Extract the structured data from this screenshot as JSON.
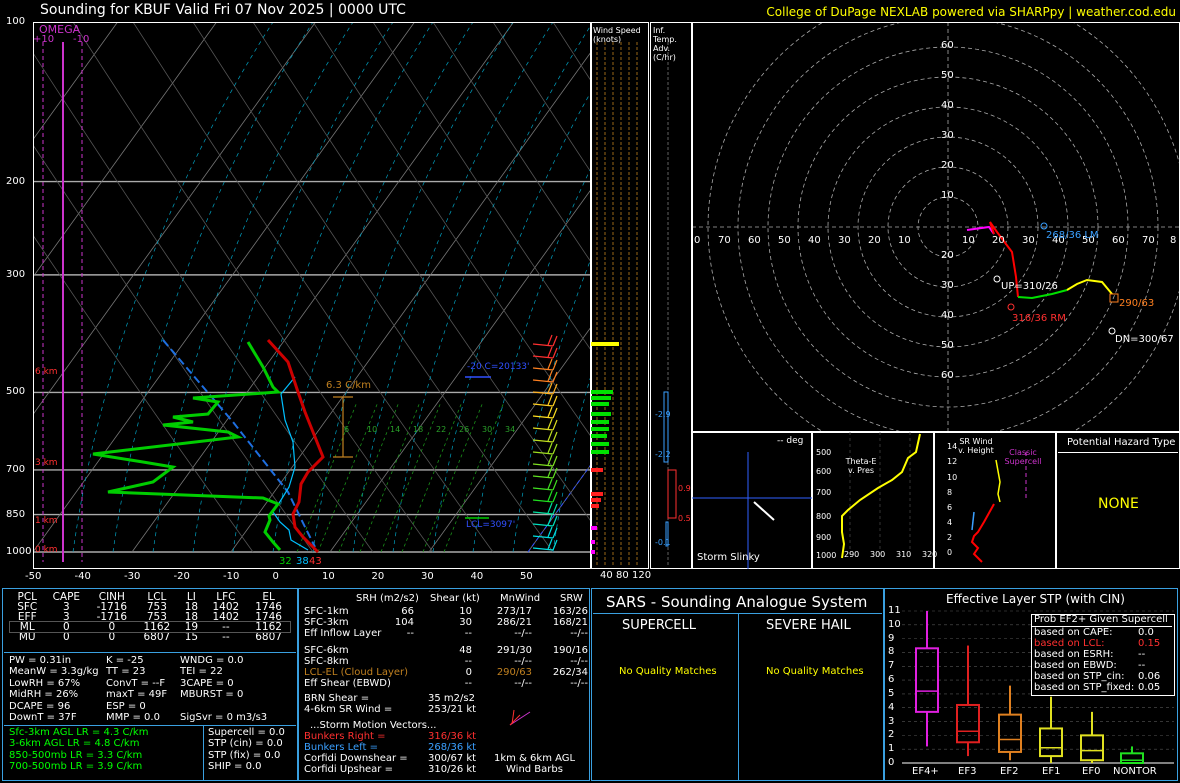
{
  "header": {
    "title": "Sounding for KBUF Valid  Fri 07 Nov 2025 | 0000 UTC",
    "credit": "College of DuPage NEXLAB powered via SHARPpy | weather.cod.edu"
  },
  "skewt": {
    "pressure_labels": [
      "100",
      "200",
      "300",
      "500",
      "700",
      "850",
      "1000"
    ],
    "temp_labels": [
      "-50",
      "-40",
      "-30",
      "-20",
      "-10",
      "0",
      "10",
      "20",
      "30",
      "40",
      "50"
    ],
    "omega_title": "OMEGA",
    "omega_plus": "+10",
    "omega_minus": "-10",
    "height_labels": [
      "6 km",
      "3 km",
      "1 km",
      "0 km"
    ],
    "lapse_rate": "6.3 C/km",
    "wetbulb_zero": "-20 C=20133'",
    "lcl_label": "LCL=3097'",
    "mixing_labels": [
      "6",
      "10",
      "14",
      "18",
      "22",
      "26",
      "30",
      "34"
    ],
    "sfc_labels": {
      "td": "32",
      "tw": "38",
      "t": "43"
    },
    "colors": {
      "temp": "#cc0000",
      "dewpoint": "#00cc00",
      "wetbulb": "#00c0ff",
      "parcel": "#1e6fe0",
      "omega": "#cc33cc"
    }
  },
  "wind_speed": {
    "title": "Wind Speed (knots)",
    "ticks": [
      "40",
      "80",
      "120"
    ]
  },
  "temp_adv": {
    "title": "Inf. Temp. Adv. (C/hr)",
    "values": [
      "-2.9",
      "-2.2",
      "0.9",
      "0.5",
      "-0.1"
    ]
  },
  "hodograph": {
    "ring_labels": [
      "60",
      "50",
      "40",
      "30",
      "20",
      "10",
      "20",
      "30",
      "40",
      "50",
      "60"
    ],
    "axis_labels": [
      "0",
      "70",
      "60",
      "50",
      "40",
      "30",
      "20",
      "10",
      "10",
      "20",
      "30",
      "40",
      "50",
      "60",
      "70",
      "8"
    ],
    "lm": "268/36 LM",
    "up": "UP=310/26",
    "rm": "316/36 RM",
    "mean": "290/63",
    "dn": "DN=300/67"
  },
  "storm_slinky": {
    "deg": "-- deg",
    "label": "Storm Slinky"
  },
  "thetae": {
    "title": "Theta-E v. Pres",
    "y_ticks": [
      "500",
      "600",
      "700",
      "800",
      "900",
      "1000"
    ],
    "x_ticks": [
      "290",
      "300",
      "310",
      "320"
    ]
  },
  "sr_wind": {
    "title": "SR Wind v. Height",
    "supercell": "Classic Supercell",
    "y_ticks": [
      "14",
      "12",
      "10",
      "8",
      "6",
      "4",
      "2",
      "0"
    ]
  },
  "hazard": {
    "title": "Potential Hazard Type",
    "value": "NONE"
  },
  "parcels": {
    "headers": [
      "PCL",
      "CAPE",
      "CINH",
      "LCL",
      "LI",
      "LFC",
      "EL"
    ],
    "rows": [
      [
        "SFC",
        "3",
        "-1716",
        "753",
        "18",
        "1402",
        "1746"
      ],
      [
        "EFF",
        "3",
        "-1716",
        "753",
        "18",
        "1402",
        "1746"
      ],
      [
        "ML",
        "0",
        "0",
        "1162",
        "19",
        "--",
        "1162"
      ],
      [
        "MU",
        "0",
        "0",
        "6807",
        "15",
        "--",
        "6807"
      ]
    ]
  },
  "indices": {
    "col1": [
      "PW = 0.31in",
      "MeanW = 3.3g/kg",
      "LowRH = 67%",
      "MidRH = 26%",
      "DCAPE = 96",
      "DownT = 37F"
    ],
    "col2": [
      "K = -25",
      "TT = 23",
      "ConvT = --F",
      "maxT = 49F",
      "ESP = 0",
      "MMP = 0.0"
    ],
    "col3": [
      "WNDG = 0.0",
      "TEI = 22",
      "3CAPE = 0",
      "MBURST = 0",
      "",
      "SigSvr = 0 m3/s3"
    ]
  },
  "lapse_rates": [
    "Sfc-3km AGL LR = 4.3 C/km",
    "3-6km AGL LR = 4.8 C/km",
    "850-500mb LR = 3.3 C/km",
    "700-500mb LR = 3.9 C/km"
  ],
  "composite": [
    "Supercell = 0.0",
    "STP (cin) = 0.0",
    "STP (fix) = 0.0",
    "SHIP = 0.0"
  ],
  "kinematics": {
    "headers": [
      "SRH (m2/s2)",
      "Shear (kt)",
      "MnWind",
      "SRW"
    ],
    "rows": [
      [
        "SFC-1km",
        "66",
        "10",
        "273/17",
        "163/26"
      ],
      [
        "SFC-3km",
        "104",
        "30",
        "286/21",
        "168/21"
      ],
      [
        "Eff Inflow Layer",
        "--",
        "--",
        "--/--",
        "--/--"
      ],
      [
        "",
        "",
        "",
        "",
        ""
      ],
      [
        "SFC-6km",
        "",
        "48",
        "291/30",
        "190/16"
      ],
      [
        "SFC-8km",
        "",
        "--",
        "--/--",
        "--/--"
      ],
      [
        "LCL-EL (Cloud Layer)",
        "",
        "0",
        "290/63",
        "262/34"
      ],
      [
        "Eff Shear (EBWD)",
        "",
        "--",
        "--/--",
        "--/--"
      ]
    ],
    "brn_shear": "BRN Shear =",
    "brn_shear_val": "35 m2/s2",
    "srwind_46": "4-6km SR Wind =",
    "srwind_46_val": "253/21 kt",
    "storm_motion": "...Storm Motion Vectors...",
    "bunkers_right": "Bunkers Right =",
    "bunkers_right_val": "316/36 kt",
    "bunkers_left": "Bunkers Left =",
    "bunkers_left_val": "268/36 kt",
    "corfidi_down": "Corfidi Downshear =",
    "corfidi_down_val": "300/67 kt",
    "corfidi_up": "Corfidi Upshear =",
    "corfidi_up_val": "310/26 kt",
    "barbs_label_1": "1km & 6km AGL",
    "barbs_label_2": "Wind Barbs"
  },
  "sars": {
    "title": "SARS - Sounding Analogue System",
    "supercell": "SUPERCELL",
    "hail": "SEVERE HAIL",
    "no_match_1": "No Quality Matches",
    "no_match_2": "No Quality Matches"
  },
  "stp": {
    "title": "Effective Layer STP (with CIN)",
    "y_ticks": [
      "11",
      "10",
      "9",
      "8",
      "7",
      "6",
      "5",
      "4",
      "3",
      "2",
      "1",
      "0"
    ],
    "categories": [
      "EF4+",
      "EF3",
      "EF2",
      "EF1",
      "EF0",
      "NONTOR"
    ],
    "legend_title": "Prob EF2+ Given Supercell",
    "legend_rows": [
      [
        "based on CAPE:",
        "0.0"
      ],
      [
        "based on LCL:",
        "0.15"
      ],
      [
        "based on ESRH:",
        "--"
      ],
      [
        "based on EBWD:",
        "--"
      ],
      [
        "based on STP_cin:",
        "0.06"
      ],
      [
        "based on STP_fixed:",
        "0.05"
      ]
    ]
  },
  "chart_data": {
    "type": "box",
    "title": "Effective Layer STP (with CIN)",
    "categories": [
      "EF4+",
      "EF3",
      "EF2",
      "EF1",
      "EF0",
      "NONTOR"
    ],
    "ylim": [
      0,
      11
    ],
    "series": [
      {
        "stat": "whisker_low",
        "values": [
          1.2,
          0.5,
          0.2,
          0.0,
          0.0,
          0.0
        ]
      },
      {
        "stat": "q1",
        "values": [
          3.7,
          1.5,
          0.8,
          0.5,
          0.2,
          0.0
        ]
      },
      {
        "stat": "median",
        "values": [
          5.2,
          2.3,
          1.7,
          1.1,
          0.9,
          0.2
        ]
      },
      {
        "stat": "q3",
        "values": [
          8.3,
          4.2,
          3.5,
          2.5,
          2.0,
          0.7
        ]
      },
      {
        "stat": "whisker_high",
        "values": [
          11.0,
          8.5,
          5.6,
          4.8,
          3.7,
          1.2
        ]
      }
    ],
    "colors": [
      "#e020e0",
      "#e02020",
      "#e08020",
      "#e0e020",
      "#e0e020",
      "#20e020"
    ]
  }
}
